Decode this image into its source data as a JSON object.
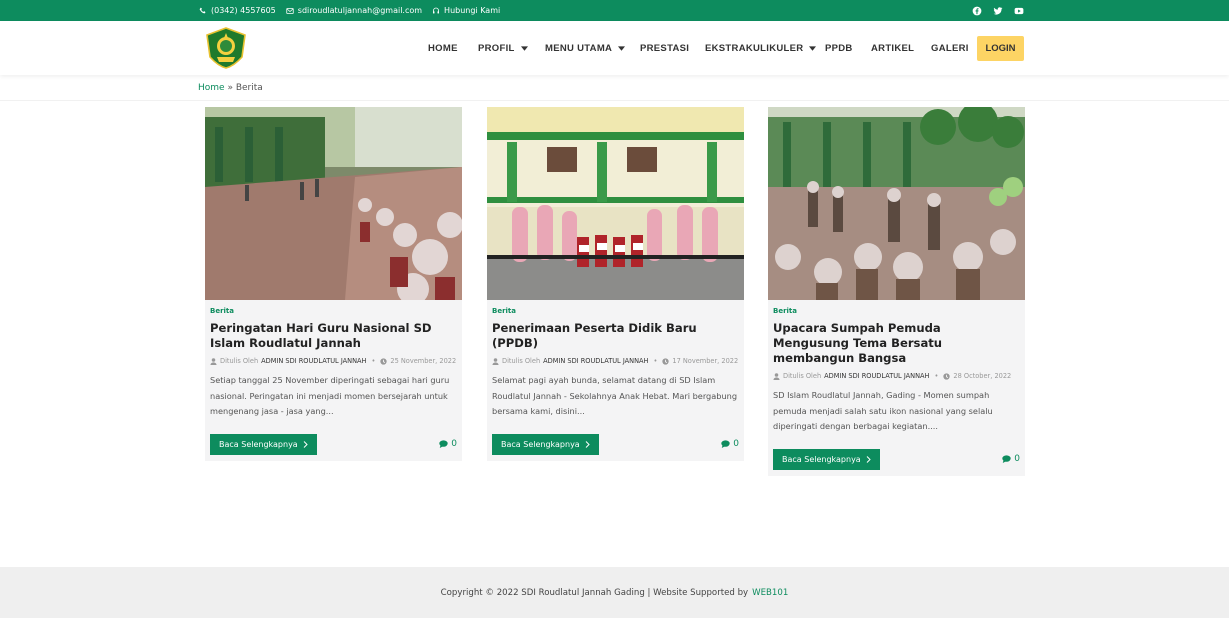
{
  "topbar": {
    "phone": "(0342) 4557605",
    "email": "sdiroudlatuljannah@gmail.com",
    "contact_link": "Hubungi Kami",
    "social_icons": [
      "facebook-icon",
      "twitter-icon",
      "youtube-icon"
    ]
  },
  "nav": {
    "home": "HOME",
    "profil": "PROFIL",
    "menu_utama": "MENU UTAMA",
    "prestasi": "PRESTASI",
    "ekstrakurikuler": "EKSTRAKULIKULER",
    "ppdb": "PPDB",
    "artikel": "ARTIKEL",
    "galeri": "GALERI",
    "login": "LOGIN"
  },
  "breadcrumb": {
    "home": "Home",
    "separator": "»",
    "current": "Berita"
  },
  "posts": [
    {
      "category": "Berita",
      "title": "Peringatan Hari Guru Nasional SD Islam Roudlatul Jannah",
      "author_prefix": "Ditulis Oleh",
      "author": "ADMIN SDI ROUDLATUL JANNAH",
      "date": "25 November, 2022",
      "excerpt": "Setiap tanggal 25 November diperingati sebagai hari guru nasional. Peringatan ini menjadi momen bersejarah untuk mengenang jasa - jasa yang...",
      "read_more": "Baca Selengkapnya",
      "comments": "0"
    },
    {
      "category": "Berita",
      "title": "Penerimaan Peserta Didik Baru (PPDB)",
      "author_prefix": "Ditulis Oleh",
      "author": "ADMIN SDI ROUDLATUL JANNAH",
      "date": "17 November, 2022",
      "excerpt": "Selamat pagi ayah bunda, selamat datang di SD Islam Roudlatul Jannah - Sekolahnya Anak Hebat. Mari bergabung bersama kami, disini...",
      "read_more": "Baca Selengkapnya",
      "comments": "0"
    },
    {
      "category": "Berita",
      "title": "Upacara Sumpah Pemuda Mengusung Tema Bersatu membangun Bangsa",
      "author_prefix": "Ditulis Oleh",
      "author": "ADMIN SDI ROUDLATUL JANNAH",
      "date": "28 October, 2022",
      "excerpt": "SD Islam Roudlatul Jannah, Gading - Momen sumpah pemuda menjadi salah satu ikon nasional yang selalu diperingati dengan berbagai kegiatan....",
      "read_more": "Baca Selengkapnya",
      "comments": "0"
    }
  ],
  "footer": {
    "copyright": "Copyright © 2022 SDI Roudlatul Jannah Gading | Website Supported by",
    "brand": "WEB101"
  },
  "colors": {
    "primary": "#0d8c5e",
    "login": "#fdd464",
    "footer_bg": "#efefef"
  }
}
